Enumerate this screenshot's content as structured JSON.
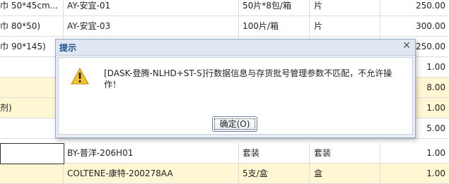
{
  "rows": [
    {
      "c0": "巾 50*45cm...",
      "c1": "AY-安宜-01",
      "c2": "50片*8包/箱",
      "c3": "片",
      "c4": "250.00",
      "yellow": false
    },
    {
      "c0": "巾 80*50)",
      "c1": "AY-安宜-03",
      "c2": "100片/箱",
      "c3": "片",
      "c4": "300.00",
      "yellow": false
    },
    {
      "c0": "巾 90*145)",
      "c1": "",
      "c2": "",
      "c3": "",
      "c4": "250.00",
      "yellow": false
    },
    {
      "c0": "",
      "c1": "",
      "c2": "",
      "c3": "",
      "c4": "1.00",
      "yellow": false
    },
    {
      "c0": "",
      "c1": "",
      "c2": "",
      "c3": "",
      "c4": "8.00",
      "yellow": true
    },
    {
      "c0": "剂)",
      "c1": "",
      "c2": "",
      "c3": "",
      "c4": "1.00",
      "yellow": true
    },
    {
      "c0": "",
      "c1": "",
      "c2": "",
      "c3": "",
      "c4": "5.00",
      "yellow": false
    },
    {
      "c0": "",
      "c1": "BY-普洋-206H01",
      "c2": "套装",
      "c3": "套装",
      "c4": "1.00",
      "yellow": false
    },
    {
      "c0": "",
      "c1": "COLTENE-康特-200278AA",
      "c2": "5支/盒",
      "c3": "盒",
      "c4": "1.00",
      "yellow": true
    }
  ],
  "dialog": {
    "title": "提示",
    "close_icon": "close-icon",
    "warning_icon": "warning-icon",
    "message": "[DASK-登腾-NLHD+ST-S]行数据信息与存货批号管理参数不匹配，不允许操作！",
    "ok_label": "确定(O)"
  }
}
